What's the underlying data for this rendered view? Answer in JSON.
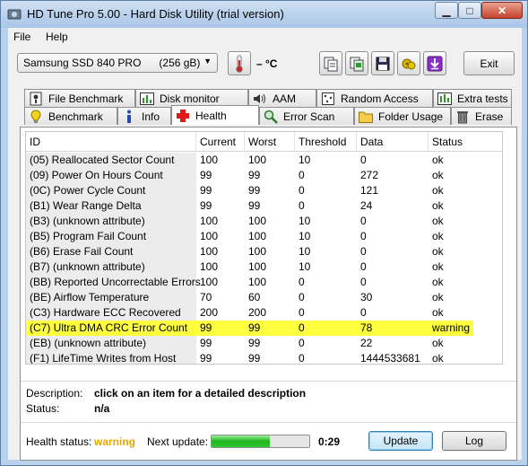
{
  "window": {
    "title": "HD Tune Pro 5.00 - Hard Disk Utility (trial version)"
  },
  "menu": [
    "File",
    "Help"
  ],
  "toolbar": {
    "drive": "Samsung SSD 840 PRO      (256 gB)",
    "temperature": "– °C",
    "exit_label": "Exit",
    "buttons": [
      "copy-text-icon",
      "copy-screenshot-icon",
      "save-icon",
      "options-icon",
      "download-icon"
    ]
  },
  "tabs_top": [
    {
      "label": "File Benchmark",
      "icon": "file-benchmark-icon"
    },
    {
      "label": "Disk monitor",
      "icon": "disk-monitor-icon"
    },
    {
      "label": "AAM",
      "icon": "speaker-icon"
    },
    {
      "label": "Random Access",
      "icon": "random-access-icon"
    },
    {
      "label": "Extra tests",
      "icon": "extra-tests-icon"
    }
  ],
  "tabs_bottom": [
    {
      "label": "Benchmark",
      "icon": "benchmark-icon"
    },
    {
      "label": "Info",
      "icon": "info-icon"
    },
    {
      "label": "Health",
      "icon": "health-icon",
      "active": true
    },
    {
      "label": "Error Scan",
      "icon": "error-scan-icon"
    },
    {
      "label": "Folder Usage",
      "icon": "folder-icon"
    },
    {
      "label": "Erase",
      "icon": "trash-icon"
    }
  ],
  "table": {
    "columns": [
      "ID",
      "Current",
      "Worst",
      "Threshold",
      "Data",
      "Status"
    ],
    "rows": [
      [
        "(05) Reallocated Sector Count",
        "100",
        "100",
        "10",
        "0",
        "ok"
      ],
      [
        "(09) Power On Hours Count",
        "99",
        "99",
        "0",
        "272",
        "ok"
      ],
      [
        "(0C) Power Cycle Count",
        "99",
        "99",
        "0",
        "121",
        "ok"
      ],
      [
        "(B1) Wear Range Delta",
        "99",
        "99",
        "0",
        "24",
        "ok"
      ],
      [
        "(B3) (unknown attribute)",
        "100",
        "100",
        "10",
        "0",
        "ok"
      ],
      [
        "(B5) Program Fail Count",
        "100",
        "100",
        "10",
        "0",
        "ok"
      ],
      [
        "(B6) Erase Fail Count",
        "100",
        "100",
        "10",
        "0",
        "ok"
      ],
      [
        "(B7) (unknown attribute)",
        "100",
        "100",
        "10",
        "0",
        "ok"
      ],
      [
        "(BB) Reported Uncorrectable Errors",
        "100",
        "100",
        "0",
        "0",
        "ok"
      ],
      [
        "(BE) Airflow Temperature",
        "70",
        "60",
        "0",
        "30",
        "ok"
      ],
      [
        "(C3) Hardware ECC Recovered",
        "200",
        "200",
        "0",
        "0",
        "ok"
      ],
      [
        "(C7) Ultra DMA CRC Error Count",
        "99",
        "99",
        "0",
        "78",
        "warning"
      ],
      [
        "(EB) (unknown attribute)",
        "99",
        "99",
        "0",
        "22",
        "ok"
      ],
      [
        "(F1) LifeTime Writes from Host",
        "99",
        "99",
        "0",
        "1444533681",
        "ok"
      ]
    ],
    "highlight_row": 11,
    "highlight_color": "#ffff40"
  },
  "details": {
    "description_label": "Description:",
    "description_value": "click on an item for a detailed description",
    "status_label": "Status:",
    "status_value": "n/a"
  },
  "footer": {
    "health_label": "Health status:",
    "health_value": "warning",
    "health_color": "#e6a800",
    "next_update_label": "Next update:",
    "progress": 0.6,
    "time": "0:29",
    "update_label": "Update",
    "log_label": "Log"
  }
}
